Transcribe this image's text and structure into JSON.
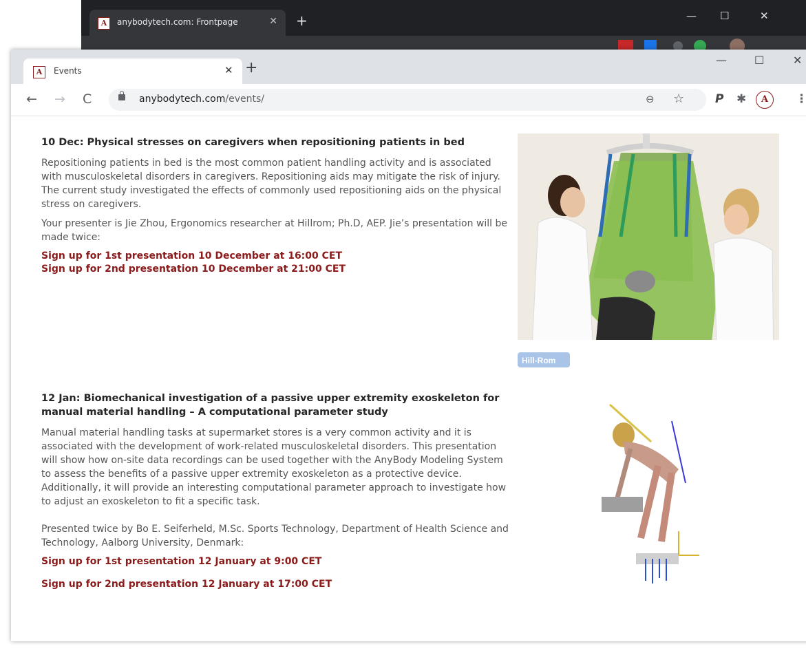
{
  "background_window": {
    "tab_title": "anybodytech.com: Frontpage",
    "favicon_letter": "A",
    "close": "✕",
    "new_tab": "+",
    "controls": {
      "minimize": "—",
      "maximize": "☐",
      "close": "✕"
    }
  },
  "window": {
    "tab": {
      "title": "Events",
      "favicon_letter": "A",
      "close": "✕"
    },
    "new_tab": "+",
    "controls": {
      "minimize": "—",
      "maximize": "☐",
      "close": "✕"
    }
  },
  "toolbar": {
    "back": "←",
    "forward": "→",
    "reload": "C",
    "url_host": "anybodytech.com",
    "url_path": "/events/",
    "zoom_icon": "⊖",
    "star_icon": "☆",
    "ext_p": "P",
    "ext_puzzle": "✱",
    "ext_a": "A",
    "menu": "⋮"
  },
  "events": [
    {
      "title": "10 Dec: Physical stresses on caregivers when repositioning patients in bed",
      "paragraphs": [
        "Repositioning patients in bed is the most common patient handling activity and is associated with musculoskeletal disorders in caregivers. Repositioning aids may mitigate the risk of injury. The current study investigated the effects of commonly used repositioning aids on the physical stress on caregivers.",
        "Your presenter is Jie Zhou, Ergonomics researcher at Hillrom; Ph.D, AEP. Jie’s presentation will be made twice:"
      ],
      "links": [
        "Sign up for 1st presentation 10 December at 16:00 CET",
        "Sign up for 2nd presentation 10 December at 21:00 CET"
      ],
      "image_label": "Hill-Rom"
    },
    {
      "title": "12 Jan: Biomechanical investigation of a passive upper extremity exoskeleton for manual material handling – A computational parameter study",
      "paragraphs": [
        "Manual material handling tasks at supermarket stores is a very common activity and it is associated with the development of work-related musculoskeletal disorders. This presentation will show how on-site data recordings can be used together with the AnyBody Modeling System to assess the benefits of a passive upper extremity exoskeleton as a protective device. Additionally, it will provide an interesting computational parameter approach to investigate how to adjust an exoskeleton to fit a specific task.",
        "Presented twice by Bo E. Seiferheld, M.Sc. Sports Technology, Department of Health Science and Technology, Aalborg University, Denmark:"
      ],
      "links": [
        "Sign up for 1st presentation 12 January at 9:00 CET",
        "Sign up for 2nd presentation 12 January at 17:00 CET"
      ]
    }
  ],
  "colors": {
    "link": "#8b1a1a",
    "heading": "#262626",
    "body_text": "#555555",
    "brand": "#8b1c1c"
  }
}
